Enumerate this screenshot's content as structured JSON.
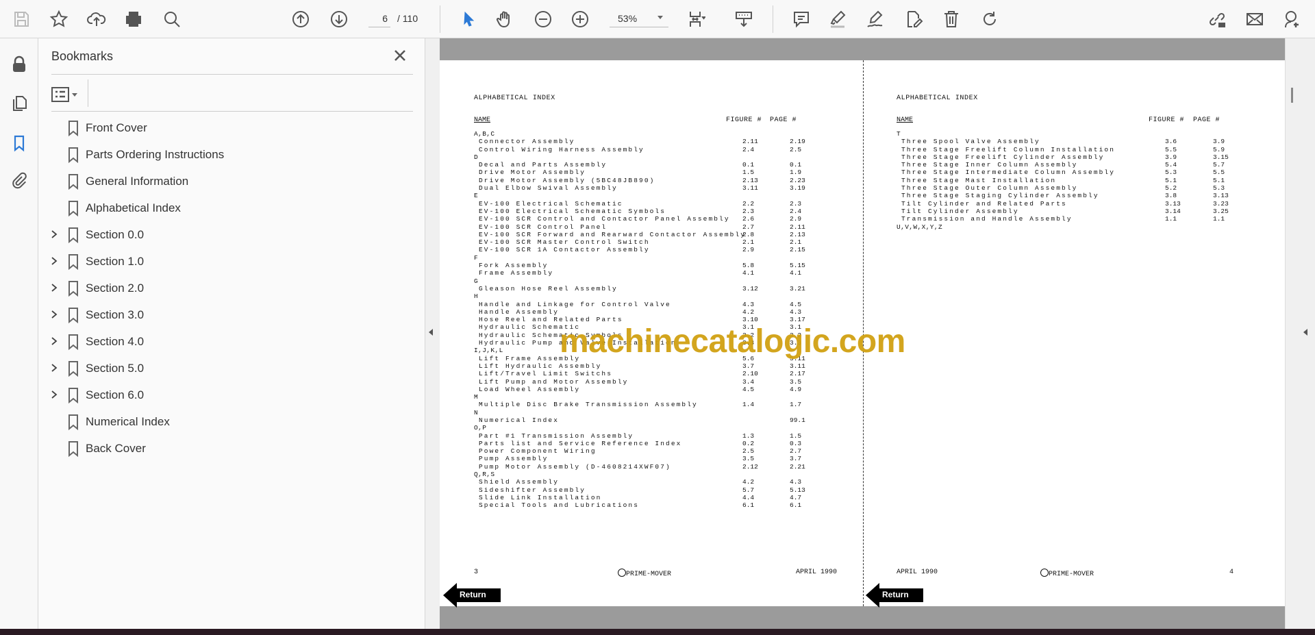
{
  "toolbar": {
    "current_page": "6",
    "total_pages": "/ 110",
    "zoom": "53%",
    "icons": [
      "save-icon",
      "star-icon",
      "upload-icon",
      "print-icon",
      "find-icon",
      "page-up-icon",
      "page-down-icon",
      "select-icon",
      "hand-icon",
      "zoom-out-icon",
      "zoom-in-icon",
      "fit-page-icon",
      "scroll-mode-icon",
      "comment-icon",
      "highlight-icon",
      "sign-icon",
      "edit-icon",
      "delete-icon",
      "rotate-icon",
      "share-link-icon",
      "mail-icon",
      "user-icon"
    ]
  },
  "panel": {
    "title": "Bookmarks",
    "items": [
      {
        "label": "Front Cover",
        "expandable": false
      },
      {
        "label": "Parts Ordering Instructions",
        "expandable": false
      },
      {
        "label": "General Information",
        "expandable": false
      },
      {
        "label": "Alphabetical Index",
        "expandable": false
      },
      {
        "label": "Section 0.0",
        "expandable": true
      },
      {
        "label": "Section 1.0",
        "expandable": true
      },
      {
        "label": "Section 2.0",
        "expandable": true
      },
      {
        "label": "Section 3.0",
        "expandable": true
      },
      {
        "label": "Section 4.0",
        "expandable": true
      },
      {
        "label": "Section 5.0",
        "expandable": true
      },
      {
        "label": "Section 6.0",
        "expandable": true
      },
      {
        "label": "Numerical Index",
        "expandable": false
      },
      {
        "label": "Back Cover",
        "expandable": false
      }
    ]
  },
  "colors": {
    "accent": "#2d7ad6",
    "watermark": "#d1a112"
  },
  "watermark": "machinecatalogic.com",
  "pages": [
    {
      "title": "ALPHABETICAL INDEX",
      "col_name": "NAME",
      "col_figure": "FIGURE #",
      "col_page": "PAGE #",
      "rows": [
        {
          "g": "A,B,C"
        },
        {
          "n": "Connector Assembly",
          "f": "2.11",
          "p": "2.19"
        },
        {
          "n": "Control Wiring Harness Assembly",
          "f": "2.4",
          "p": "2.5"
        },
        {
          "g": "D"
        },
        {
          "n": "Decal and Parts Assembly",
          "f": "0.1",
          "p": "0.1"
        },
        {
          "n": "Drive Motor Assembly",
          "f": "1.5",
          "p": "1.9"
        },
        {
          "n": "Drive Motor Assembly (5BC48JB890)",
          "f": "2.13",
          "p": "2.23"
        },
        {
          "n": "Dual Elbow Swival Assembly",
          "f": "3.11",
          "p": "3.19"
        },
        {
          "g": "E"
        },
        {
          "n": "EV-100 Electrical Schematic",
          "f": "2.2",
          "p": "2.3"
        },
        {
          "n": "EV-100 Electrical Schematic Symbols",
          "f": "2.3",
          "p": "2.4"
        },
        {
          "n": "EV-100 SCR Control and Contactor Panel Assembly",
          "f": "2.6",
          "p": "2.9"
        },
        {
          "n": "EV-100 SCR Control Panel",
          "f": "2.7",
          "p": "2.11"
        },
        {
          "n": "EV-100 SCR Forward and Rearward Contactor Assembly",
          "f": "2.8",
          "p": "2.13"
        },
        {
          "n": "EV-100 SCR Master Control Switch",
          "f": "2.1",
          "p": "2.1"
        },
        {
          "n": "EV-100 SCR 1A Contactor Assembly",
          "f": "2.9",
          "p": "2.15"
        },
        {
          "g": "F"
        },
        {
          "n": "Fork Assembly",
          "f": "5.8",
          "p": "5.15"
        },
        {
          "n": "Frame Assembly",
          "f": "4.1",
          "p": "4.1"
        },
        {
          "g": "G"
        },
        {
          "n": "Gleason Hose Reel Assembly",
          "f": "3.12",
          "p": "3.21"
        },
        {
          "g": "H"
        },
        {
          "n": "Handle and Linkage for Control Valve",
          "f": "4.3",
          "p": "4.5"
        },
        {
          "n": "Handle Assembly",
          "f": "4.2",
          "p": "4.3"
        },
        {
          "n": "Hose Reel and Related Parts",
          "f": "3.10",
          "p": "3.17"
        },
        {
          "n": "Hydraulic Schematic",
          "f": "3.1",
          "p": "3.1"
        },
        {
          "n": "Hydraulic Schematic Symbols",
          "f": "3.2",
          "p": "3.2"
        },
        {
          "n": "Hydraulic Pump and Valve Installation",
          "f": "3.3",
          "p": "3.3"
        },
        {
          "g": "I,J,K,L"
        },
        {
          "n": "Lift Frame Assembly",
          "f": "5.6",
          "p": "5.11"
        },
        {
          "n": "Lift Hydraulic Assembly",
          "f": "3.7",
          "p": "3.11"
        },
        {
          "n": "Lift/Travel Limit Switchs",
          "f": "2.10",
          "p": "2.17"
        },
        {
          "n": "Lift Pump and Motor Assembly",
          "f": "3.4",
          "p": "3.5"
        },
        {
          "n": "Load Wheel Assembly",
          "f": "4.5",
          "p": "4.9"
        },
        {
          "g": "M"
        },
        {
          "n": "Multiple Disc Brake Transmission Assembly",
          "f": "1.4",
          "p": "1.7"
        },
        {
          "g": "N"
        },
        {
          "n": "Numerical Index",
          "f": "",
          "p": "99.1"
        },
        {
          "g": "O,P"
        },
        {
          "n": "Part #1 Transmission Assembly",
          "f": "1.3",
          "p": "1.5"
        },
        {
          "n": "Parts list and Service Reference Index",
          "f": "0.2",
          "p": "0.3"
        },
        {
          "n": "Power Component Wiring",
          "f": "2.5",
          "p": "2.7"
        },
        {
          "n": "Pump Assembly",
          "f": "3.5",
          "p": "3.7"
        },
        {
          "n": "Pump Motor Assembly (D-4608214XWF07)",
          "f": "2.12",
          "p": "2.21"
        },
        {
          "g": "Q,R,S"
        },
        {
          "n": "Shield Assembly",
          "f": "4.2",
          "p": "4.3"
        },
        {
          "n": "Sideshifter Assembly",
          "f": "5.7",
          "p": "5.13"
        },
        {
          "n": "Slide Link Installation",
          "f": "4.4",
          "p": "4.7"
        },
        {
          "n": "Special Tools and Lubrications",
          "f": "6.1",
          "p": "6.1"
        }
      ],
      "footer": {
        "left": "3",
        "center": "PRIME-MOVER",
        "right": "APRIL 1990"
      },
      "return_label": "Return"
    },
    {
      "title": "ALPHABETICAL INDEX",
      "col_name": "NAME",
      "col_figure": "FIGURE #",
      "col_page": "PAGE #",
      "rows": [
        {
          "g": "T"
        },
        {
          "n": "Three Spool Valve Assembly",
          "f": "3.6",
          "p": "3.9"
        },
        {
          "n": "Three Stage Freelift Column Installation",
          "f": "5.5",
          "p": "5.9"
        },
        {
          "n": "Three Stage Freelift Cylinder Assembly",
          "f": "3.9",
          "p": "3.15"
        },
        {
          "n": "Three Stage Inner Column Assembly",
          "f": "5.4",
          "p": "5.7"
        },
        {
          "n": "Three Stage Intermediate Column Assembly",
          "f": "5.3",
          "p": "5.5"
        },
        {
          "n": "Three Stage Mast Installation",
          "f": "5.1",
          "p": "5.1"
        },
        {
          "n": "Three Stage Outer Column Assembly",
          "f": "5.2",
          "p": "5.3"
        },
        {
          "n": "Three Stage Staging Cylinder Assembly",
          "f": "3.8",
          "p": "3.13"
        },
        {
          "n": "Tilt Cylinder and Related Parts",
          "f": "3.13",
          "p": "3.23"
        },
        {
          "n": "Tilt Cylinder Assembly",
          "f": "3.14",
          "p": "3.25"
        },
        {
          "n": "Transmission and Handle Assembly",
          "f": "1.1",
          "p": "1.1"
        },
        {
          "g": "U,V,W,X,Y,Z"
        }
      ],
      "footer": {
        "left": "APRIL 1990",
        "center": "PRIME-MOVER",
        "right": "4"
      },
      "return_label": "Return"
    }
  ]
}
